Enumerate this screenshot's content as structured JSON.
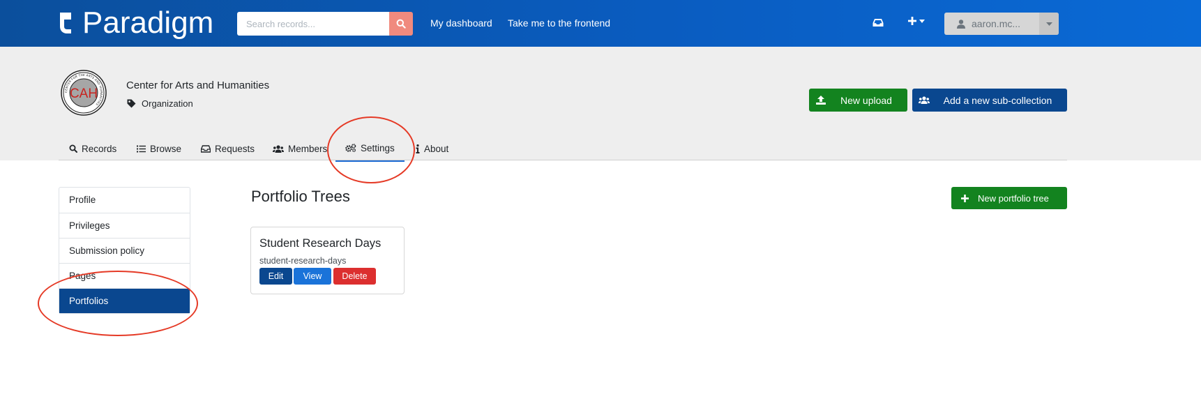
{
  "brand": {
    "name": "Paradigm"
  },
  "search": {
    "placeholder": "Search records..."
  },
  "topnav": {
    "dashboard": "My dashboard",
    "frontend": "Take me to the frontend"
  },
  "user": {
    "name": "aaron.mc..."
  },
  "org": {
    "name": "Center for Arts and Humanities",
    "type": "Organization",
    "logo_initials": "CAH",
    "logo_ring_text": "CENTER FOR THE ARTS AND HUMANITIES"
  },
  "actions": {
    "new_upload": "New upload",
    "add_sub_collection": "Add a new sub-collection"
  },
  "tabs": [
    {
      "label": "Records"
    },
    {
      "label": "Browse"
    },
    {
      "label": "Requests"
    },
    {
      "label": "Members"
    },
    {
      "label": "Settings"
    },
    {
      "label": "About"
    }
  ],
  "sidebar": {
    "items": [
      {
        "label": "Profile"
      },
      {
        "label": "Privileges"
      },
      {
        "label": "Submission policy"
      },
      {
        "label": "Pages"
      },
      {
        "label": "Portfolios"
      }
    ]
  },
  "main": {
    "title": "Portfolio Trees",
    "new_tree": "New portfolio tree",
    "card": {
      "title": "Student Research Days",
      "slug": "student-research-days",
      "edit": "Edit",
      "view": "View",
      "delete": "Delete"
    }
  },
  "colors": {
    "primary": "#0a478f",
    "success": "#13831f",
    "danger": "#dc2f2f",
    "annotation": "#e53a26"
  }
}
